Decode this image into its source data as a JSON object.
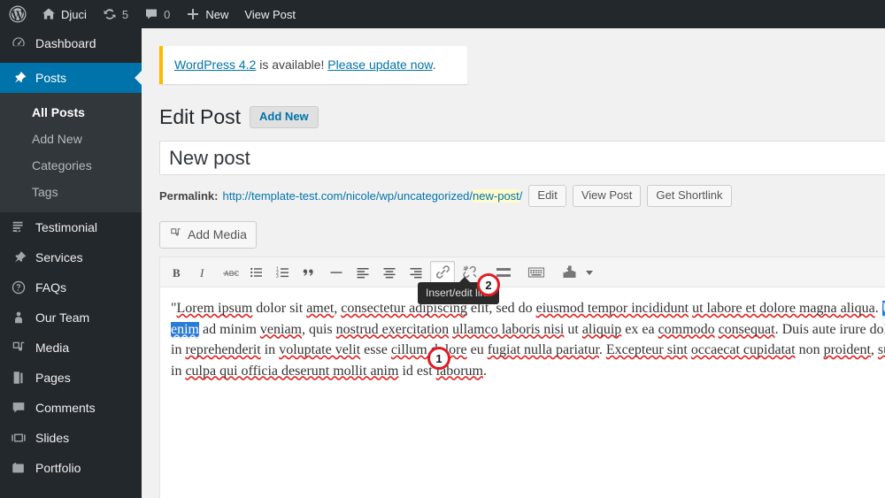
{
  "adminbar": {
    "logo_icon": "wordpress-logo-icon",
    "site_name": "Djuci",
    "home_icon": "home-icon",
    "updates_icon": "updates-icon",
    "updates_count": "5",
    "comments_icon": "comment-bubble-icon",
    "comments_count": "0",
    "new_icon": "plus-icon",
    "new_label": "New",
    "view_post_label": "View Post"
  },
  "sidebar": {
    "items": [
      {
        "label": "Dashboard",
        "icon": "dashboard-icon",
        "current": false
      },
      {
        "label": "Posts",
        "icon": "pin-icon",
        "current": true
      },
      {
        "label": "Testimonial",
        "icon": "testimonial-icon",
        "current": false
      },
      {
        "label": "Services",
        "icon": "pin-icon",
        "current": false
      },
      {
        "label": "FAQs",
        "icon": "question-mark-icon",
        "current": false
      },
      {
        "label": "Our Team",
        "icon": "user-icon",
        "current": false
      },
      {
        "label": "Media",
        "icon": "media-icon",
        "current": false
      },
      {
        "label": "Pages",
        "icon": "pages-icon",
        "current": false
      },
      {
        "label": "Comments",
        "icon": "comment-bubble-icon",
        "current": false
      },
      {
        "label": "Slides",
        "icon": "slides-icon",
        "current": false
      },
      {
        "label": "Portfolio",
        "icon": "portfolio-icon",
        "current": false
      }
    ],
    "submenu": [
      {
        "label": "All Posts",
        "current": true
      },
      {
        "label": "Add New",
        "current": false
      },
      {
        "label": "Categories",
        "current": false
      },
      {
        "label": "Tags",
        "current": false
      }
    ]
  },
  "notice": {
    "link_version": "WordPress 4.2",
    "middle": " is available! ",
    "link_update": "Please update now",
    "period": "."
  },
  "page": {
    "title": "Edit Post",
    "add_new_label": "Add New"
  },
  "post": {
    "title_value": "New post"
  },
  "permalink": {
    "label": "Permalink:",
    "url_prefix": "http://template-test.com/nicole/wp/uncategorized/",
    "slug": "new-post",
    "url_suffix": "/",
    "edit_label": "Edit",
    "view_post_label": "View Post",
    "get_shortlink_label": "Get Shortlink"
  },
  "media": {
    "add_media_label": "Add Media",
    "add_media_icon": "media-icon"
  },
  "toolbar": {
    "buttons": [
      {
        "name": "bold-icon",
        "title": "Bold",
        "active": false
      },
      {
        "name": "italic-icon",
        "title": "Italic",
        "active": false
      },
      {
        "name": "strikethrough-icon",
        "title": "Strikethrough",
        "active": false
      },
      {
        "name": "bulleted-list-icon",
        "title": "Bulleted list",
        "active": false
      },
      {
        "name": "numbered-list-icon",
        "title": "Numbered list",
        "active": false
      },
      {
        "name": "blockquote-icon",
        "title": "Blockquote",
        "active": false
      },
      {
        "name": "horizontal-rule-icon",
        "title": "Horizontal line",
        "active": false
      },
      {
        "name": "align-left-icon",
        "title": "Align left",
        "active": false
      },
      {
        "name": "align-center-icon",
        "title": "Align center",
        "active": false
      },
      {
        "name": "align-right-icon",
        "title": "Align right",
        "active": false
      },
      {
        "name": "insert-link-icon",
        "title": "Insert/edit link",
        "active": true
      },
      {
        "name": "unlink-icon",
        "title": "Remove link",
        "active": false
      },
      {
        "name": "insert-more-tag-icon",
        "title": "Insert Read More tag",
        "active": false
      },
      {
        "name": "toolbar-toggle-icon",
        "title": "Toolbar Toggle",
        "active": false
      },
      {
        "name": "plugin-icon",
        "title": "Plugin",
        "active": false
      }
    ],
    "caret_icon": "chevron-down-icon",
    "tooltip_text": "Insert/edit link"
  },
  "editor": {
    "line1_open_quote": "\"",
    "para": {
      "l1_a": "Lorem ipsum",
      "l1_b": " dolor sit ",
      "l1_c": "amet",
      "l1_d": ", ",
      "l1_e": "consectetur adipiscing",
      "l1_f": " elit, sed do ",
      "l1_g": "eiusmod tempor incididunt",
      "l2_a": "ut labore et dolore magna ",
      "l2_b": "aliqua",
      "l2_c": ". ",
      "l2_sel": "Ut enim",
      "l2_d": " ad minim ",
      "l2_e": "veniam",
      "l2_f": ", quis ",
      "l2_g": "nostrud exercitation",
      "l3_a": "ullamco laboris nisi",
      "l3_b": " ut ",
      "l3_c": "aliquip",
      "l3_d": " ex ea ",
      "l3_e": "commodo",
      "l3_f": " ",
      "l3_g": "consequat",
      "l3_h": ". Duis aute irure dolor in",
      "l4_a": "reprehenderit",
      "l4_b": " in ",
      "l4_c": "voluptate velit",
      "l4_d": " esse ",
      "l4_e": "cillum dolore",
      "l4_f": " eu ",
      "l4_g": "fugiat nulla pariatur",
      "l4_h": ". ",
      "l4_i": "Excepteur sint",
      "l5_a": "occaecat cupidatat",
      "l5_b": " non ",
      "l5_c": "proident",
      "l5_d": ", ",
      "l5_e": "sunt",
      "l5_f": " in ",
      "l5_g": "culpa qui officia deserunt mollit anim",
      "l5_h": " id est",
      "l6_a": "laborum",
      "l6_b": "."
    }
  },
  "markers": [
    {
      "label": "1"
    },
    {
      "label": "2"
    }
  ],
  "colors": {
    "admin_bar_bg": "#23282d",
    "sidebar_bg": "#23282d",
    "submenu_bg": "#32373c",
    "accent_blue": "#0073aa",
    "notice_accent": "#ffba00",
    "slug_highlight": "#fffbcc",
    "selection_blue": "#2a7bd6",
    "marker_red": "#e01b24",
    "spellcheck_red": "#e02020",
    "content_bg": "#f1f1f1"
  }
}
